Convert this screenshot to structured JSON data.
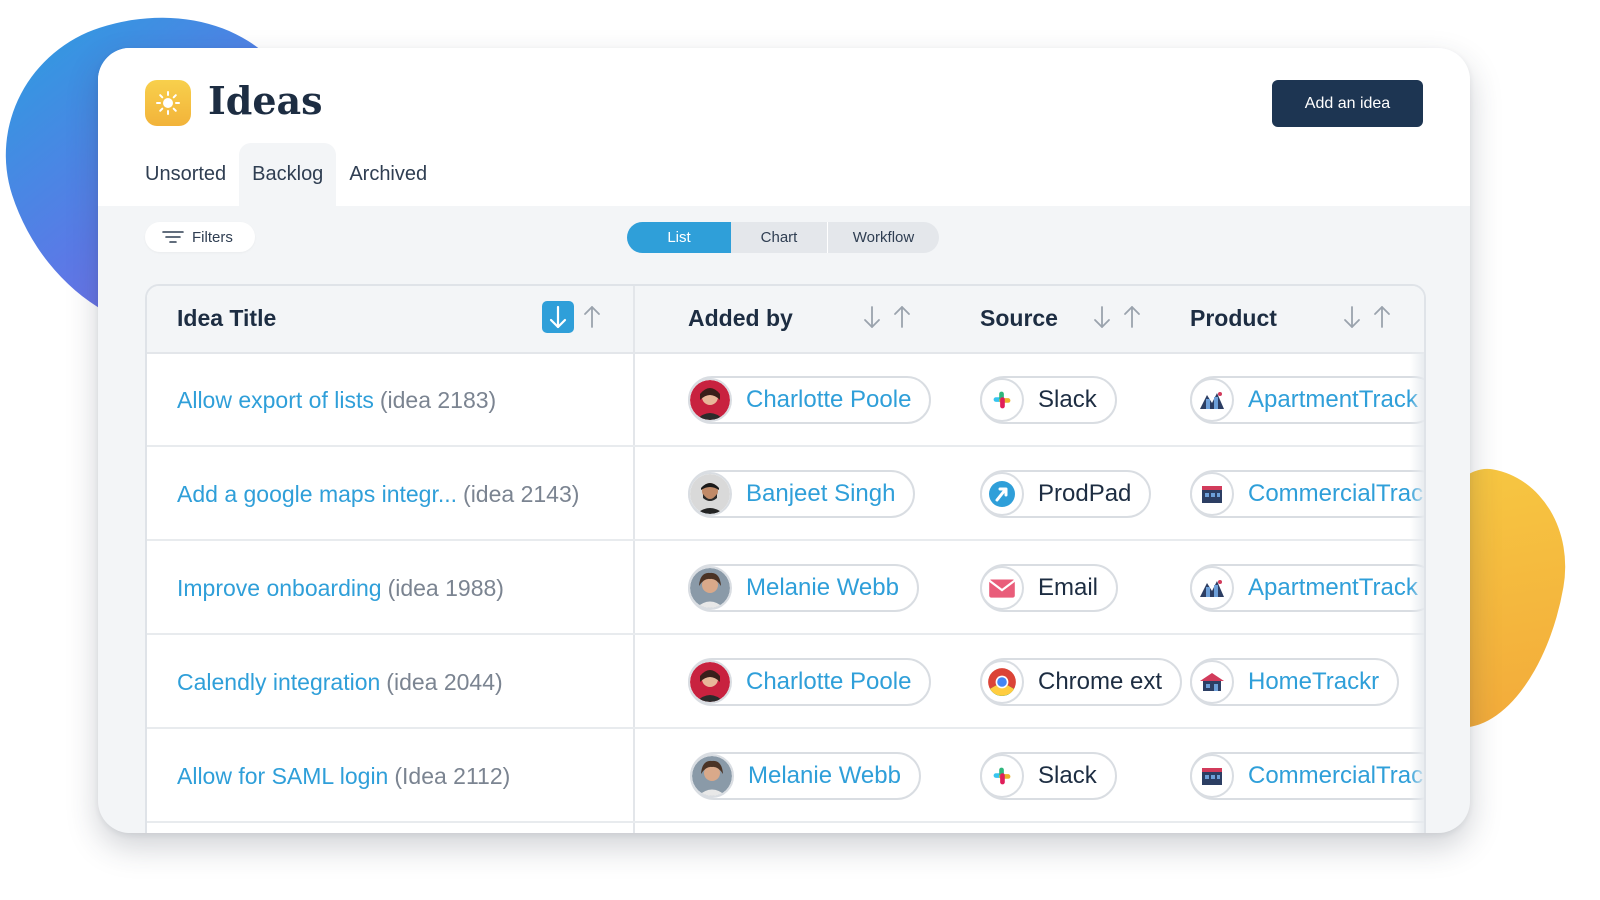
{
  "app": {
    "title": "Ideas",
    "add_button_label": "Add an idea"
  },
  "tabs": [
    {
      "label": "Unsorted",
      "active": false
    },
    {
      "label": "Backlog",
      "active": true
    },
    {
      "label": "Archived",
      "active": false
    }
  ],
  "toolbar": {
    "filters_label": "Filters",
    "views": [
      {
        "label": "List",
        "active": true
      },
      {
        "label": "Chart",
        "active": false
      },
      {
        "label": "Workflow",
        "active": false
      }
    ]
  },
  "table": {
    "columns": [
      {
        "label": "Idea Title",
        "sort": "descending"
      },
      {
        "label": "Added by",
        "sort": "none"
      },
      {
        "label": "Source",
        "sort": "none"
      },
      {
        "label": "Product",
        "sort": "none"
      }
    ],
    "rows": [
      {
        "title": "Allow export of lists",
        "id": "(idea 2183)",
        "added_by": "Charlotte Poole",
        "added_by_avatar": "charlotte-avatar",
        "source": "Slack",
        "source_icon": "slack-icon",
        "product": "ApartmentTrack",
        "product_icon": "apartment-track-icon"
      },
      {
        "title": "Add a google maps integr...",
        "id": "(idea 2143)",
        "added_by": "Banjeet Singh",
        "added_by_avatar": "banjeet-avatar",
        "source": "ProdPad",
        "source_icon": "prodpad-icon",
        "product": "CommercialTrac",
        "product_icon": "commercial-track-icon"
      },
      {
        "title": "Improve onboarding",
        "id": "(idea 1988)",
        "added_by": "Melanie Webb",
        "added_by_avatar": "melanie-avatar",
        "source": "Email",
        "source_icon": "email-icon",
        "product": "ApartmentTrack",
        "product_icon": "apartment-track-icon"
      },
      {
        "title": "Calendly integration",
        "id": "(idea 2044)",
        "added_by": "Charlotte Poole",
        "added_by_avatar": "charlotte-avatar",
        "source": "Chrome ext",
        "source_icon": "chrome-icon",
        "product": "HomeTrackr",
        "product_icon": "home-trackr-icon"
      },
      {
        "title": "Allow for SAML login",
        "id": "(Idea 2112)",
        "added_by": "Melanie Webb",
        "added_by_avatar": "melanie-avatar",
        "source": "Slack",
        "source_icon": "slack-icon",
        "product": "CommercialTrac",
        "product_icon": "commercial-track-icon"
      }
    ]
  },
  "colors": {
    "accent": "#2f9fd9",
    "primary_dark": "#1d3552",
    "title_text": "#1d2d42",
    "muted_text": "#7b8491",
    "brand_yellow": "#f8d04c"
  }
}
